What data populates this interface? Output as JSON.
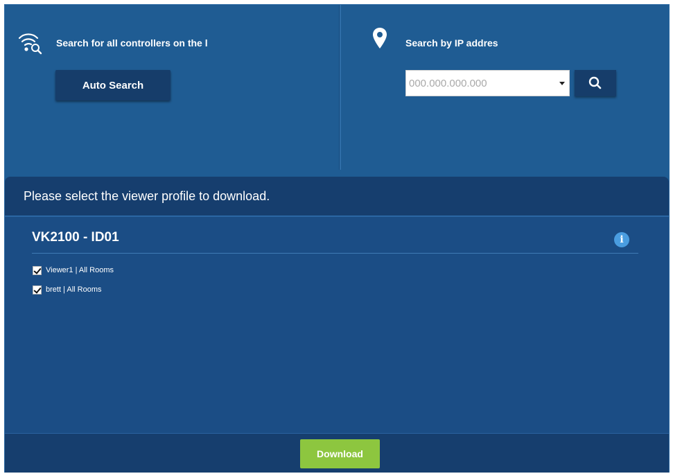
{
  "search": {
    "auto": {
      "title": "Search for all controllers on the l",
      "button_label": "Auto Search",
      "icon": "wifi-search-icon"
    },
    "ip": {
      "title": "Search by IP addres",
      "placeholder": "000.000.000.000",
      "value": "",
      "icon": "location-pin-icon",
      "button_icon": "magnifier-icon"
    }
  },
  "panel": {
    "header": "Please select the viewer profile to download.",
    "device": {
      "name": "VK2100 - ID01",
      "info_icon": "i",
      "profiles": [
        {
          "label": "Viewer1 | All Rooms",
          "checked": true
        },
        {
          "label": "brett | All Rooms",
          "checked": true
        }
      ]
    }
  },
  "footer": {
    "download_label": "Download"
  },
  "colors": {
    "background": "#1f5c93",
    "panel": "#1b4d85",
    "header_bar": "#163e6e",
    "button_dark": "#163d6a",
    "download": "#8dc63f",
    "info": "#4a9de0"
  }
}
